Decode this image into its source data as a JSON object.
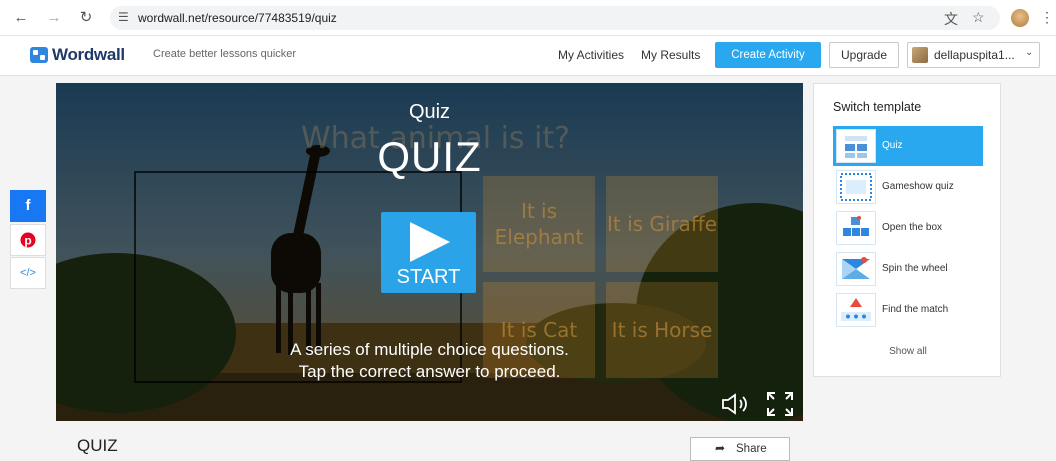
{
  "browser": {
    "url": "wordwall.net/resource/77483519/quiz",
    "back_icon": "arrow-left-icon",
    "forward_icon": "arrow-right-icon",
    "reload_icon": "reload-icon",
    "site_info_icon": "tune-icon",
    "translate_icon": "translate-icon",
    "bookmark_icon": "star-icon",
    "menu_icon": "kebab-menu-icon"
  },
  "header": {
    "logo_text": "Wordwall",
    "tagline": "Create better lessons quicker",
    "my_activities": "My Activities",
    "my_results": "My Results",
    "create_activity": "Create Activity",
    "upgrade": "Upgrade",
    "user_name": "dellapuspita1...",
    "accent": "#29a8f0"
  },
  "share_sidebar": {
    "facebook": "f",
    "embed": "</>"
  },
  "game": {
    "question": "What animal is it?",
    "answers": [
      "It is Elephant",
      "It is Giraffe",
      "It is Cat",
      "It is Horse"
    ],
    "title_small": "Quiz",
    "title_big": "QUIZ",
    "start_label": "START",
    "description_line1": "A series of multiple choice questions.",
    "description_line2": "Tap the correct answer to proceed."
  },
  "templates": {
    "title": "Switch template",
    "items": [
      {
        "label": "Quiz",
        "active": true
      },
      {
        "label": "Gameshow quiz",
        "active": false
      },
      {
        "label": "Open the box",
        "active": false
      },
      {
        "label": "Spin the wheel",
        "active": false
      },
      {
        "label": "Find the match",
        "active": false
      }
    ],
    "show_all": "Show all"
  },
  "activity": {
    "title": "QUIZ",
    "share_label": "Share"
  }
}
